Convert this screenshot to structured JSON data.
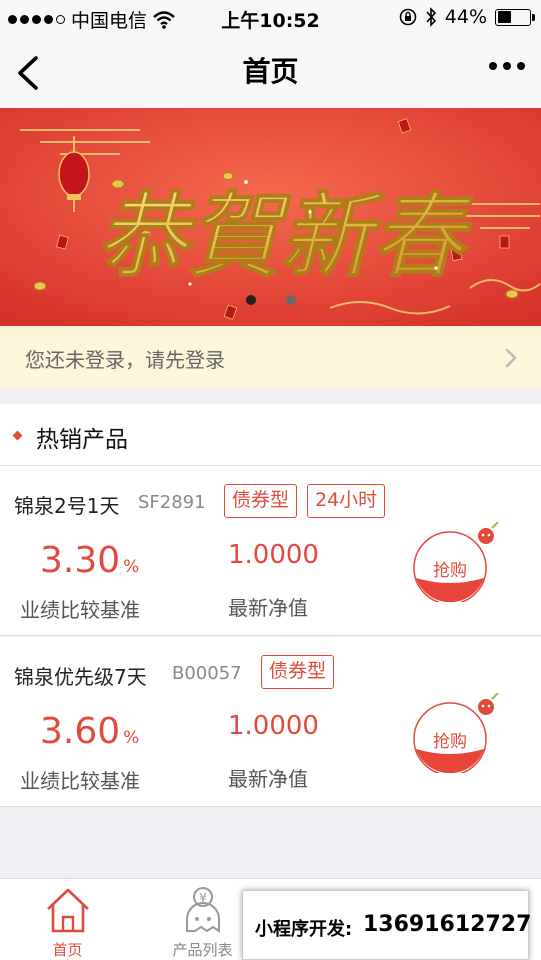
{
  "status_bar": {
    "carrier": "中国电信",
    "time": "上午10:52",
    "battery": "44%",
    "battery_level": 0.44
  },
  "nav": {
    "title": "首页",
    "back_icon": "chevron-left-icon",
    "more_icon": "more-dots-icon"
  },
  "banner": {
    "text": "恭賀新春",
    "lantern_text": "恭賀新春",
    "slide_count": 2,
    "active_slide": 0
  },
  "login_bar": {
    "text": "您还未登录，请先登录"
  },
  "section": {
    "title": "热销产品"
  },
  "products": [
    {
      "name": "锦泉2号1天",
      "code": "SF2891",
      "tags": [
        "债券型",
        "24小时"
      ],
      "rate": "3.30",
      "rate_unit": "%",
      "rate_label": "业绩比较基准",
      "nav_value": "1.0000",
      "nav_label": "最新净值",
      "buy_label": "抢购"
    },
    {
      "name": "锦泉优先级7天",
      "code": "B00057",
      "tags": [
        "债券型"
      ],
      "rate": "3.60",
      "rate_unit": "%",
      "rate_label": "业绩比较基准",
      "nav_value": "1.0000",
      "nav_label": "最新净值",
      "buy_label": "抢购"
    }
  ],
  "tabbar": {
    "items": [
      {
        "label": "首页",
        "icon": "home-icon",
        "active": true
      },
      {
        "label": "产品列表",
        "icon": "product-list-icon",
        "active": false
      },
      {
        "label": "",
        "icon": "tab-icon-3",
        "active": false
      },
      {
        "label": "",
        "icon": "tab-icon-4",
        "active": false
      }
    ]
  },
  "promo": {
    "label": "小程序开发:",
    "phone": "13691612727"
  },
  "colors": {
    "accent": "#e24a3c",
    "banner_red": "#e8453a",
    "gold": "#e6b84a",
    "login_bg": "#fdf6d8"
  }
}
